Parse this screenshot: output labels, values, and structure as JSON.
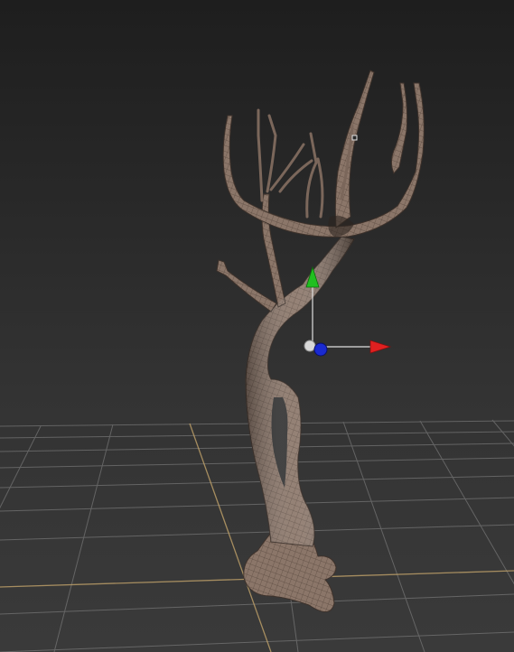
{
  "viewport": {
    "view": "perspective",
    "background_color": "#2b2b2b",
    "grid_color": "#8a8a8a",
    "grid_axis_color": "#c2a36a"
  },
  "object": {
    "type": "tree-trunk-mesh",
    "material_color": "#8b7669",
    "wireframe_color": "#5a4a40"
  },
  "gizmo": {
    "type": "move-transform-gizmo",
    "axes": [
      {
        "axis": "x",
        "color": "#e02020"
      },
      {
        "axis": "y",
        "color": "#20c020"
      },
      {
        "axis": "z",
        "color": "#1a2ad0"
      }
    ],
    "pivot_color": "#d8d8d8"
  }
}
